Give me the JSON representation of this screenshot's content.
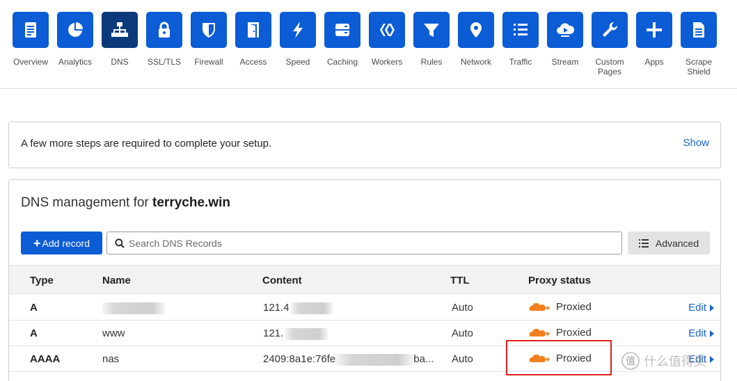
{
  "nav": {
    "items": [
      {
        "label": "Overview",
        "icon": "document-icon",
        "active": false
      },
      {
        "label": "Analytics",
        "icon": "pie-chart-icon",
        "active": false
      },
      {
        "label": "DNS",
        "icon": "network-tree-icon",
        "active": true
      },
      {
        "label": "SSL/TLS",
        "icon": "lock-icon",
        "active": false
      },
      {
        "label": "Firewall",
        "icon": "shield-icon",
        "active": false
      },
      {
        "label": "Access",
        "icon": "door-icon",
        "active": false
      },
      {
        "label": "Speed",
        "icon": "lightning-icon",
        "active": false
      },
      {
        "label": "Caching",
        "icon": "server-icon",
        "active": false
      },
      {
        "label": "Workers",
        "icon": "workers-icon",
        "active": false
      },
      {
        "label": "Rules",
        "icon": "filter-icon",
        "active": false
      },
      {
        "label": "Network",
        "icon": "location-pin-icon",
        "active": false
      },
      {
        "label": "Traffic",
        "icon": "list-icon",
        "active": false
      },
      {
        "label": "Stream",
        "icon": "cloud-play-icon",
        "active": false
      },
      {
        "label": "Custom\nPages",
        "icon": "wrench-icon",
        "active": false
      },
      {
        "label": "Apps",
        "icon": "plus-icon",
        "active": false
      },
      {
        "label": "Scrape\nShield",
        "icon": "page-icon",
        "active": false
      }
    ]
  },
  "banner": {
    "text": "A few more steps are required to complete your setup.",
    "show_label": "Show"
  },
  "dns": {
    "title_prefix": "DNS management for ",
    "domain": "terryche.win",
    "add_record_label": "Add record",
    "search_placeholder": "Search DNS Records",
    "advanced_label": "Advanced",
    "columns": {
      "type": "Type",
      "name": "Name",
      "content": "Content",
      "ttl": "TTL",
      "proxy": "Proxy status"
    },
    "rows": [
      {
        "type": "A",
        "name": "",
        "content": "121.4",
        "content_tail": "",
        "ttl": "Auto",
        "proxy": "Proxied",
        "edit": "Edit"
      },
      {
        "type": "A",
        "name": "www",
        "content": "121.",
        "content_tail": "",
        "ttl": "Auto",
        "proxy": "Proxied",
        "edit": "Edit"
      },
      {
        "type": "AAAA",
        "name": "nas",
        "content": "2409:8a1e:76fe",
        "content_tail": "ba...",
        "ttl": "Auto",
        "proxy": "Proxied",
        "edit": "Edit"
      }
    ]
  },
  "watermark": {
    "text": "值 什么值得买",
    "circle": "值"
  },
  "colors": {
    "accent": "#0b5cd5",
    "accent_active": "#0a3a7a",
    "link": "#1a62c9",
    "cloud": "#f38020",
    "highlight": "#e02020"
  }
}
